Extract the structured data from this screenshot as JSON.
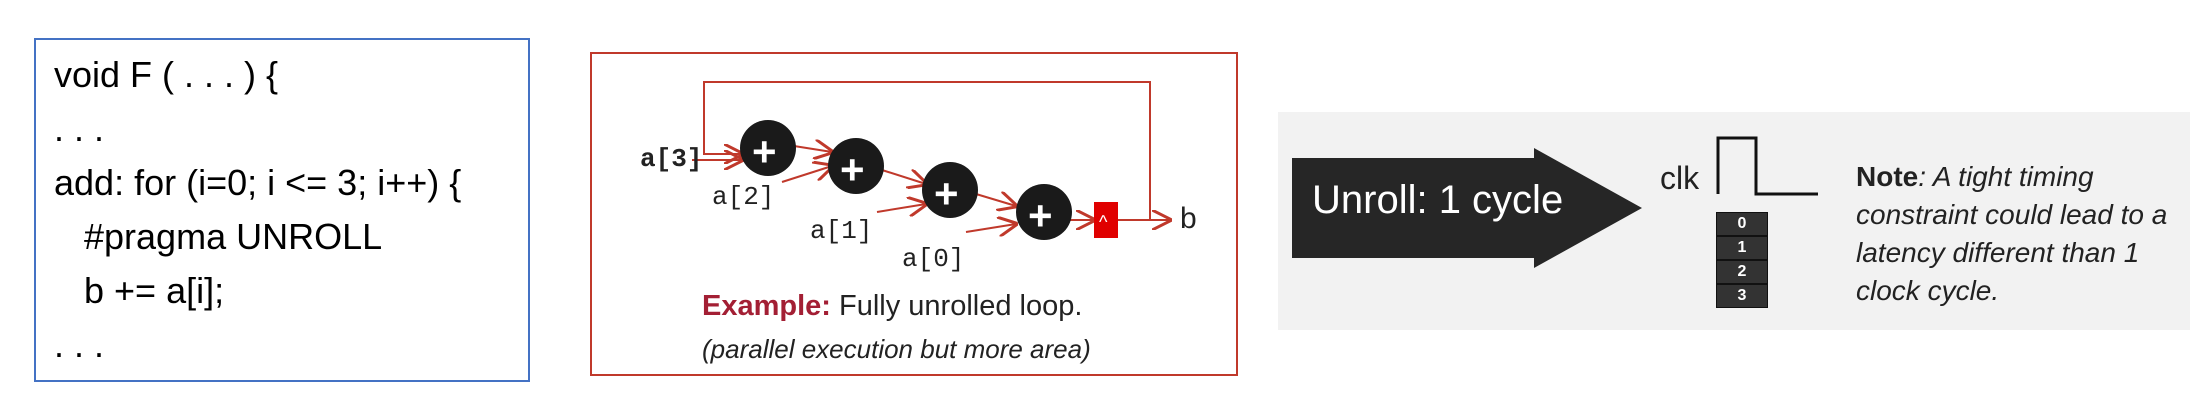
{
  "code": {
    "lines": [
      "void F ( . . . ) {",
      ". . .",
      "add: for (i=0; i <= 3; i++) {",
      "   #pragma UNROLL",
      "   b += a[i];",
      ". . ."
    ]
  },
  "diagram": {
    "inputs": [
      "a[3]",
      "a[2]",
      "a[1]",
      "a[0]"
    ],
    "adder_symbol": "+",
    "register_symbol": "^",
    "output": "b",
    "example_title": "Example:",
    "example_text": "Fully unrolled loop.",
    "note": "(parallel execution but more area)",
    "accent_color": "#c0392b"
  },
  "timing": {
    "arrow_label": "Unroll: 1 cycle",
    "clock_label": "clk",
    "cycles": [
      "0",
      "1",
      "2",
      "3"
    ],
    "note_title": "Note",
    "note_text": ": A tight timing constraint could lead to a latency different than 1 clock cycle."
  }
}
